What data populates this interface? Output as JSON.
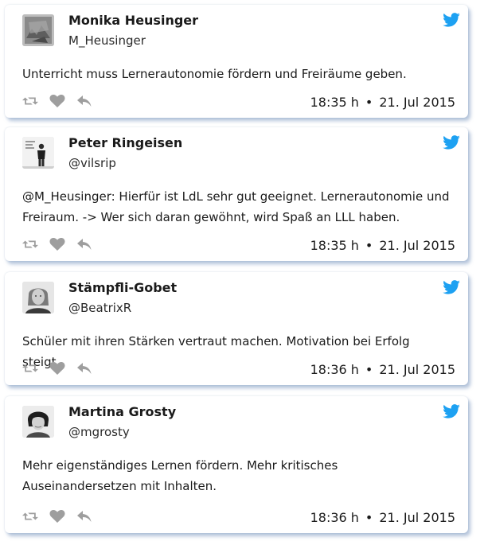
{
  "tweets": [
    {
      "name": "Monika Heusinger",
      "handle": "M_Heusinger",
      "text": "Unterricht muss Lernerautonomie fördern und Freiräume geben.",
      "time": "18:35 h",
      "separator": "•",
      "date": "21. Jul 2015"
    },
    {
      "name": "Peter Ringeisen",
      "handle": "@vilsrip",
      "text": "@M_Heusinger: Hierfür ist LdL sehr gut geeignet. Lernerautonomie und Freiraum. -> Wer sich daran gewöhnt, wird Spaß an LLL haben.",
      "time": "18:35 h",
      "separator": "•",
      "date": "21. Jul 2015"
    },
    {
      "name": "Stämpfli-Gobet",
      "handle": "@BeatrixR",
      "text": "Schüler mit ihren Stärken vertraut machen. Motivation bei Erfolg steigt.",
      "time": "18:36 h",
      "separator": "•",
      "date": "21. Jul 2015"
    },
    {
      "name": "Martina Grosty",
      "handle": "@mgrosty",
      "text": "Mehr eigenständiges Lernen fördern. Mehr kritisches Auseinandersetzen mit Inhalten.",
      "time": "18:36 h",
      "separator": "•",
      "date": "21. Jul 2015"
    }
  ],
  "icons": {
    "brand": "twitter-bird-icon",
    "actions": [
      "retweet-icon",
      "like-heart-icon",
      "reply-arrow-icon"
    ]
  },
  "colors": {
    "brand": "#1da1f2",
    "action_icon": "#9e9e9e",
    "card_shadow": "#7896be"
  }
}
